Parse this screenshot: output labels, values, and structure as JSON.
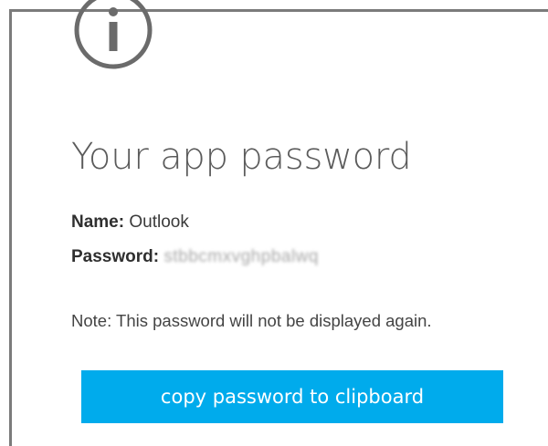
{
  "dialog": {
    "icon": "info-icon",
    "title": "Your app password",
    "name_label": "Name:",
    "name_value": "Outlook",
    "password_label": "Password:",
    "password_value": "stbbcmxvghpbalwq",
    "note": "Note: This password will not be displayed again.",
    "copy_button_label": "copy password to clipboard"
  },
  "colors": {
    "accent": "#00abec",
    "title_text": "#5b5b5b",
    "icon_gray": "#6b6b6b",
    "border": "#7b7b7b"
  }
}
